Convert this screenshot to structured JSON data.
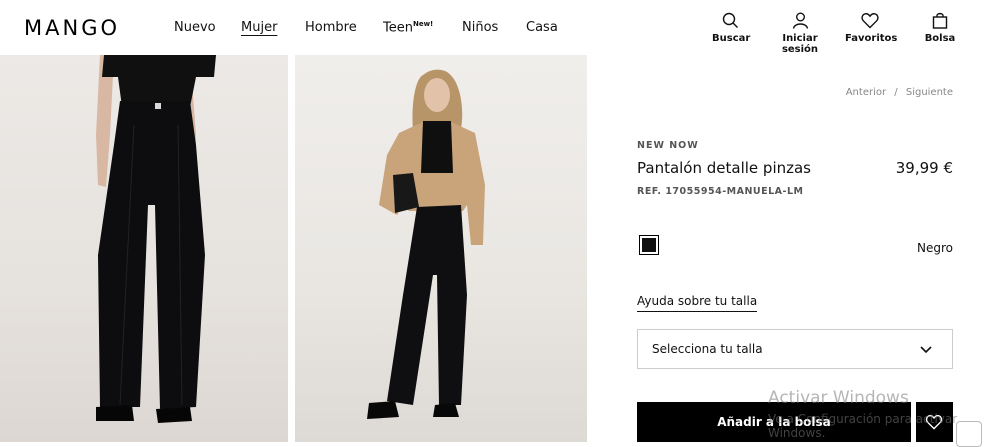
{
  "header": {
    "logo": "MANGO",
    "nav": [
      {
        "label": "Nuevo",
        "active": false
      },
      {
        "label": "Mujer",
        "active": true
      },
      {
        "label": "Hombre",
        "active": false
      },
      {
        "label": "Teen",
        "badge": "New!",
        "active": false
      },
      {
        "label": "Niños",
        "active": false
      },
      {
        "label": "Casa",
        "active": false
      }
    ],
    "tools": {
      "search": {
        "label": "Buscar",
        "icon": "search-icon"
      },
      "login": {
        "label": "Iniciar sesión",
        "icon": "user-icon"
      },
      "favorites": {
        "label": "Favoritos",
        "icon": "heart-icon"
      },
      "bag": {
        "label": "Bolsa",
        "icon": "bag-icon"
      }
    }
  },
  "product": {
    "pager": {
      "prev": "Anterior",
      "sep": "/",
      "next": "Siguiente"
    },
    "tag": "NEW NOW",
    "title": "Pantalón detalle pinzas",
    "price": "39,99 €",
    "ref": "REF. 17055954-MANUELA-LM",
    "color": {
      "name": "Negro",
      "hex": "#111111"
    },
    "size_help": "Ayuda sobre tu talla",
    "size_select": "Selecciona tu talla",
    "add_button": "Añadir a la bolsa"
  },
  "os_overlay": {
    "line1": "Activar Windows",
    "line2": "Ve a Configuración para activar Windows."
  }
}
